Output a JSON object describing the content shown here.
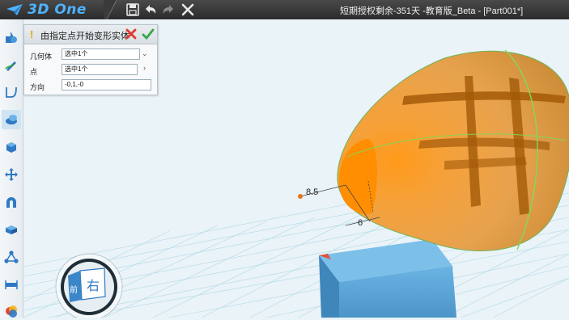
{
  "app": {
    "logo_text": "3D One",
    "window_title": "短期授权剩余-351天 -教育版_Beta - [Part001*]"
  },
  "quick_access": [
    "save-icon",
    "undo-icon",
    "redo-icon",
    "close-icon"
  ],
  "left_toolbar": {
    "tools": [
      "primitive-shapes-icon",
      "sketch-icon",
      "sketch-edit-icon",
      "special-features-icon",
      "feature-modeling-icon",
      "basic-edit-icon",
      "combine-icon",
      "draw-edit-icon",
      "array-icon",
      "measure-icon",
      "color-render-icon"
    ],
    "active_index": 3
  },
  "command_panel": {
    "title": "由指定点开始变形实体",
    "warning_symbol": "!",
    "rows": [
      {
        "label": "几何体",
        "value": "选中1个"
      },
      {
        "label": "点",
        "value": "选中1个"
      },
      {
        "label": "方向",
        "value": "-0,1,-0"
      }
    ]
  },
  "viewport": {
    "dimension_labels": [
      "8.5",
      "6"
    ],
    "view_cube_label": "右",
    "view_cube_side_label": "前"
  },
  "colors": {
    "accent": "#4fb3ff",
    "shape_orange": "#f39a1b",
    "box_blue": "#5ba4d6",
    "grid": "#9fd3e6",
    "selection_green": "#7ddc5a"
  }
}
